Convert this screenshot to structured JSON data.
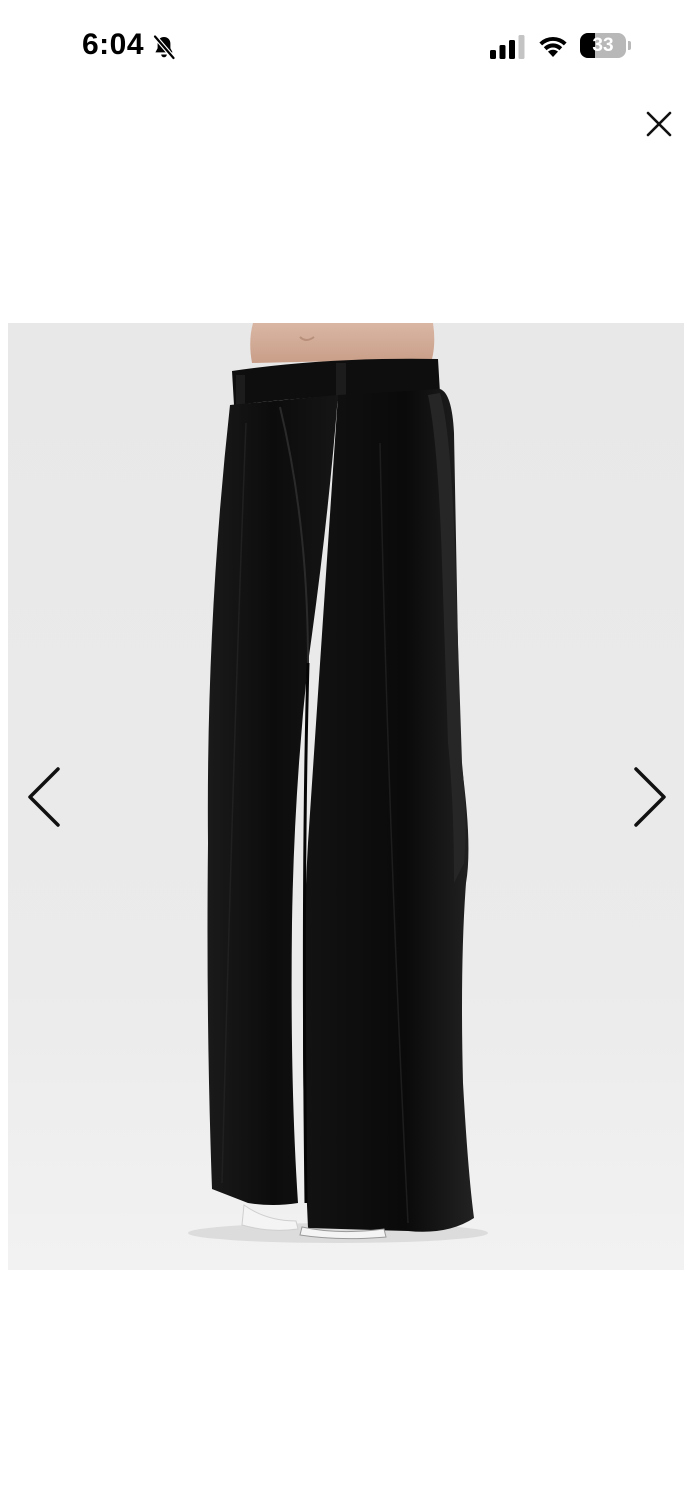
{
  "status_bar": {
    "time": "6:04",
    "battery_level": "33",
    "battery_fraction": 0.33,
    "icons": [
      "bell-off-icon",
      "cellular-signal-icon",
      "wifi-icon",
      "battery-icon"
    ]
  },
  "viewer": {
    "close_icon": "close-icon",
    "prev_icon": "chevron-left-icon",
    "next_icon": "chevron-right-icon",
    "image_content": "product-photo-wide-leg-trousers"
  },
  "colors": {
    "background": "#ffffff",
    "photo_background": "#ebebeb",
    "icon": "#111111"
  }
}
